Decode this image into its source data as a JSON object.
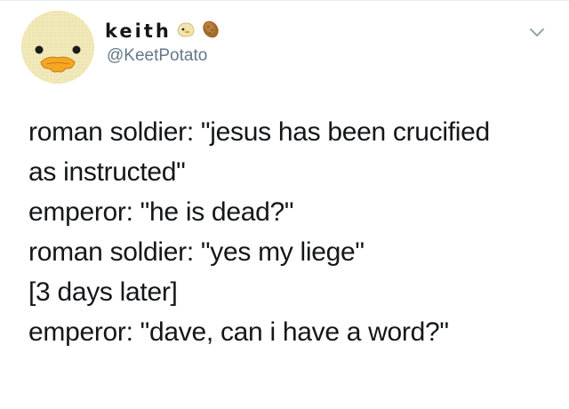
{
  "author": {
    "display_name": "keith",
    "handle": "@KeetPotato",
    "avatar_icon": "duck-face-icon",
    "name_emojis": [
      "duck-face-emoji-icon",
      "potato-emoji-icon"
    ]
  },
  "tweet": {
    "lines": [
      "roman soldier: \"jesus has been crucified",
      "as instructed\"",
      "emperor: \"he is dead?\"",
      "roman soldier: \"yes my liege\"",
      "[3 days later]",
      "emperor: \"dave, can i have a word?\""
    ]
  },
  "colors": {
    "text": "#14171a",
    "secondary_text": "#657786",
    "avatar_background": "#efe7b4",
    "beak": "#f5a623"
  }
}
